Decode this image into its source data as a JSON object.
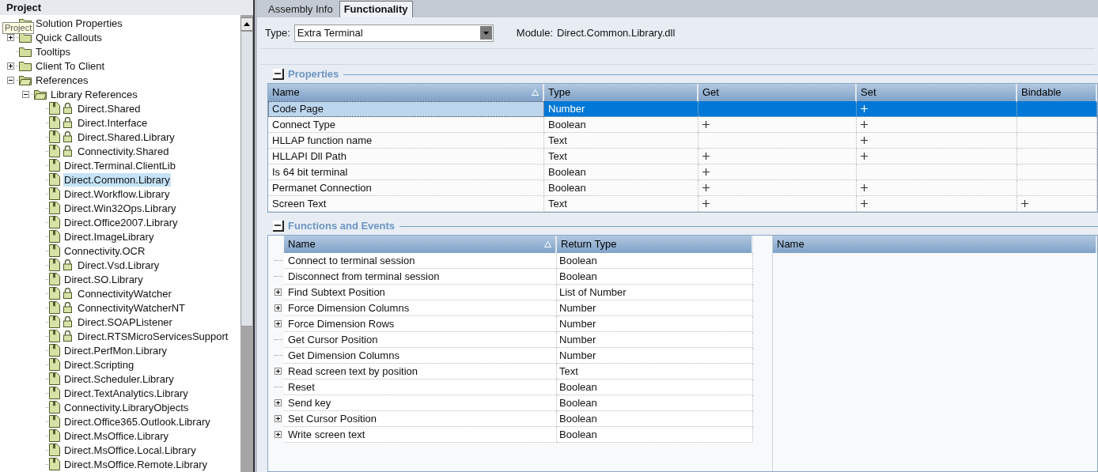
{
  "project_panel": {
    "title": "Project",
    "tooltip": "Project",
    "tree": [
      {
        "label": "Solution Properties",
        "kind": "folder",
        "selected": false
      },
      {
        "label": "Quick Callouts",
        "kind": "folder",
        "expanded": false,
        "selected": false
      },
      {
        "label": "Tooltips",
        "kind": "folder",
        "selected": false
      },
      {
        "label": "Client To Client",
        "kind": "folder",
        "expanded": false,
        "selected": false
      },
      {
        "label": "References",
        "kind": "folder",
        "expanded": true,
        "selected": false,
        "children": [
          {
            "label": "Library References",
            "kind": "folder",
            "expanded": true,
            "selected": false,
            "children": [
              {
                "label": "Direct.Shared",
                "kind": "library",
                "locked": true,
                "selected": false
              },
              {
                "label": "Direct.Interface",
                "kind": "library",
                "locked": true,
                "selected": false
              },
              {
                "label": "Direct.Shared.Library",
                "kind": "library",
                "locked": true,
                "selected": false
              },
              {
                "label": "Connectivity.Shared",
                "kind": "library",
                "locked": true,
                "selected": false
              },
              {
                "label": "Direct.Terminal.ClientLib",
                "kind": "library",
                "locked": false,
                "selected": false
              },
              {
                "label": "Direct.Common.Library",
                "kind": "library",
                "locked": false,
                "selected": true
              },
              {
                "label": "Direct.Workflow.Library",
                "kind": "library",
                "locked": false,
                "selected": false
              },
              {
                "label": "Direct.Win32Ops.Library",
                "kind": "library",
                "locked": false,
                "selected": false
              },
              {
                "label": "Direct.Office2007.Library",
                "kind": "library",
                "locked": false,
                "selected": false
              },
              {
                "label": "Direct.ImageLibrary",
                "kind": "library",
                "locked": false,
                "selected": false
              },
              {
                "label": "Connectivity.OCR",
                "kind": "library",
                "locked": false,
                "selected": false
              },
              {
                "label": "Direct.Vsd.Library",
                "kind": "library",
                "locked": true,
                "selected": false
              },
              {
                "label": "Direct.SO.Library",
                "kind": "library",
                "locked": false,
                "selected": false
              },
              {
                "label": "ConnectivityWatcher",
                "kind": "library",
                "locked": true,
                "selected": false
              },
              {
                "label": "ConnectivityWatcherNT",
                "kind": "library",
                "locked": true,
                "selected": false
              },
              {
                "label": "Direct.SOAPListener",
                "kind": "library",
                "locked": true,
                "selected": false
              },
              {
                "label": "Direct.RTSMicroServicesSupport",
                "kind": "library",
                "locked": true,
                "selected": false
              },
              {
                "label": "Direct.PerfMon.Library",
                "kind": "library",
                "locked": false,
                "selected": false
              },
              {
                "label": "Direct.Scripting",
                "kind": "library",
                "locked": false,
                "selected": false
              },
              {
                "label": "Direct.Scheduler.Library",
                "kind": "library",
                "locked": false,
                "selected": false
              },
              {
                "label": "Direct.TextAnalytics.Library",
                "kind": "library",
                "locked": false,
                "selected": false
              },
              {
                "label": "Connectivity.LibraryObjects",
                "kind": "library",
                "locked": false,
                "selected": false
              },
              {
                "label": "Direct.Office365.Outlook.Library",
                "kind": "library",
                "locked": false,
                "selected": false
              },
              {
                "label": "Direct.MsOffice.Library",
                "kind": "library",
                "locked": false,
                "selected": false
              },
              {
                "label": "Direct.MsOffice.Local.Library",
                "kind": "library",
                "locked": false,
                "selected": false
              },
              {
                "label": "Direct.MsOffice.Remote.Library",
                "kind": "library",
                "locked": false,
                "selected": false
              }
            ]
          }
        ]
      }
    ]
  },
  "tabs": [
    {
      "label": "Assembly Info",
      "selected": false
    },
    {
      "label": "Functionality",
      "selected": true
    }
  ],
  "type_field": {
    "label": "Type:",
    "value": "Extra Terminal"
  },
  "module": {
    "label": "Module:",
    "value": "Direct.Common.Library.dll"
  },
  "properties": {
    "title": "Properties",
    "expanded": true,
    "columns": [
      "Name",
      "Type",
      "Get",
      "Set",
      "Bindable"
    ],
    "rows": [
      {
        "name": "Code Page",
        "type": "Number",
        "get": false,
        "set": true,
        "bindable": false,
        "selected": true
      },
      {
        "name": "Connect Type",
        "type": "Boolean",
        "get": true,
        "set": true,
        "bindable": false,
        "selected": false
      },
      {
        "name": "HLLAP function name",
        "type": "Text",
        "get": false,
        "set": true,
        "bindable": false,
        "selected": false
      },
      {
        "name": "HLLAPI Dll Path",
        "type": "Text",
        "get": true,
        "set": true,
        "bindable": false,
        "selected": false
      },
      {
        "name": "Is 64 bit terminal",
        "type": "Boolean",
        "get": true,
        "set": false,
        "bindable": false,
        "selected": false
      },
      {
        "name": "Permanet Connection",
        "type": "Boolean",
        "get": true,
        "set": true,
        "bindable": false,
        "selected": false
      },
      {
        "name": "Screen Text",
        "type": "Text",
        "get": true,
        "set": true,
        "bindable": true,
        "selected": false
      }
    ]
  },
  "functions": {
    "title": "Functions and Events",
    "expanded": true,
    "columns": [
      "Name",
      "Return Type"
    ],
    "detail_columns": [
      "Name"
    ],
    "rows": [
      {
        "name": "Connect to terminal session",
        "return_type": "Boolean",
        "expandable": false
      },
      {
        "name": "Disconnect from terminal session",
        "return_type": "Boolean",
        "expandable": false
      },
      {
        "name": "Find Subtext Position",
        "return_type": "List of Number",
        "expandable": true
      },
      {
        "name": "Force Dimension Columns",
        "return_type": "Number",
        "expandable": true
      },
      {
        "name": "Force Dimension Rows",
        "return_type": "Number",
        "expandable": true
      },
      {
        "name": "Get Cursor Position",
        "return_type": "Number",
        "expandable": false
      },
      {
        "name": "Get Dimension Columns",
        "return_type": "Number",
        "expandable": false
      },
      {
        "name": "Read screen text by position",
        "return_type": "Text",
        "expandable": true
      },
      {
        "name": "Reset",
        "return_type": "Boolean",
        "expandable": false
      },
      {
        "name": "Send key",
        "return_type": "Boolean",
        "expandable": true
      },
      {
        "name": "Set Cursor Position",
        "return_type": "Boolean",
        "expandable": true
      },
      {
        "name": "Write screen text",
        "return_type": "Boolean",
        "expandable": true
      }
    ]
  }
}
